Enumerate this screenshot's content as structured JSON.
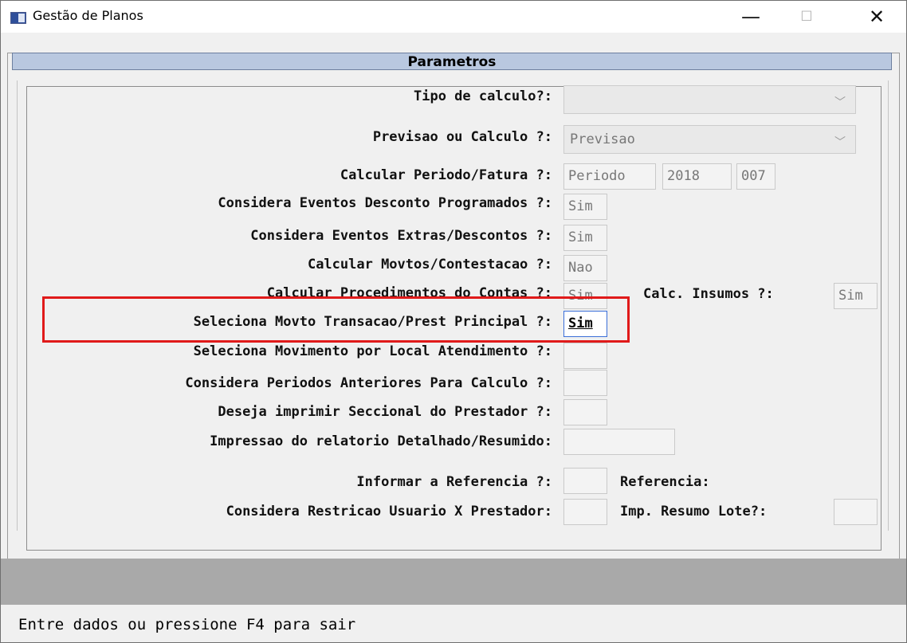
{
  "window": {
    "title": "Gestão de Planos",
    "controls": {
      "minimize": "—",
      "maximize": "☐",
      "close": "✕"
    }
  },
  "panel": {
    "header": "Parametros"
  },
  "form": {
    "tipo_calculo": {
      "label": "Tipo de calculo?:",
      "value": ""
    },
    "previsao_calculo": {
      "label": "Previsao ou Calculo ?:",
      "value": "Previsao"
    },
    "calcular_periodo": {
      "label": "Calcular Periodo/Fatura ?:",
      "mode": "Periodo",
      "year": "2018",
      "period": "007"
    },
    "considera_desconto_prog": {
      "label": "Considera Eventos Desconto Programados ?:",
      "value": "Sim"
    },
    "considera_extras": {
      "label": "Considera Eventos Extras/Descontos ?:",
      "value": "Sim"
    },
    "calcular_movtos": {
      "label": "Calcular Movtos/Contestacao ?:",
      "value": "Nao"
    },
    "calcular_procedimentos": {
      "label": "Calcular Procedimentos do Contas ?:",
      "value": "Sim"
    },
    "calc_insumos": {
      "label": "Calc. Insumos ?:",
      "value": "Sim"
    },
    "seleciona_movto": {
      "label": "Seleciona Movto Transacao/Prest Principal ?:",
      "value": "Sim"
    },
    "seleciona_local": {
      "label": "Seleciona Movimento por Local Atendimento ?:",
      "value": ""
    },
    "considera_periodos": {
      "label": "Considera Periodos Anteriores Para Calculo ?:",
      "value": ""
    },
    "imprimir_seccional": {
      "label": "Deseja imprimir Seccional do Prestador ?:",
      "value": ""
    },
    "impressao_relatorio": {
      "label": "Impressao do relatorio Detalhado/Resumido:",
      "value": ""
    },
    "informar_referencia": {
      "label": "Informar a Referencia ?:",
      "value": ""
    },
    "referencia": {
      "label": "Referencia:"
    },
    "restricao_usuario": {
      "label": "Considera Restricao Usuario X Prestador:",
      "value": ""
    },
    "imp_resumo_lote": {
      "label": "Imp. Resumo Lote?:",
      "value": ""
    }
  },
  "status": {
    "message": "Entre dados ou pressione F4 para sair"
  }
}
